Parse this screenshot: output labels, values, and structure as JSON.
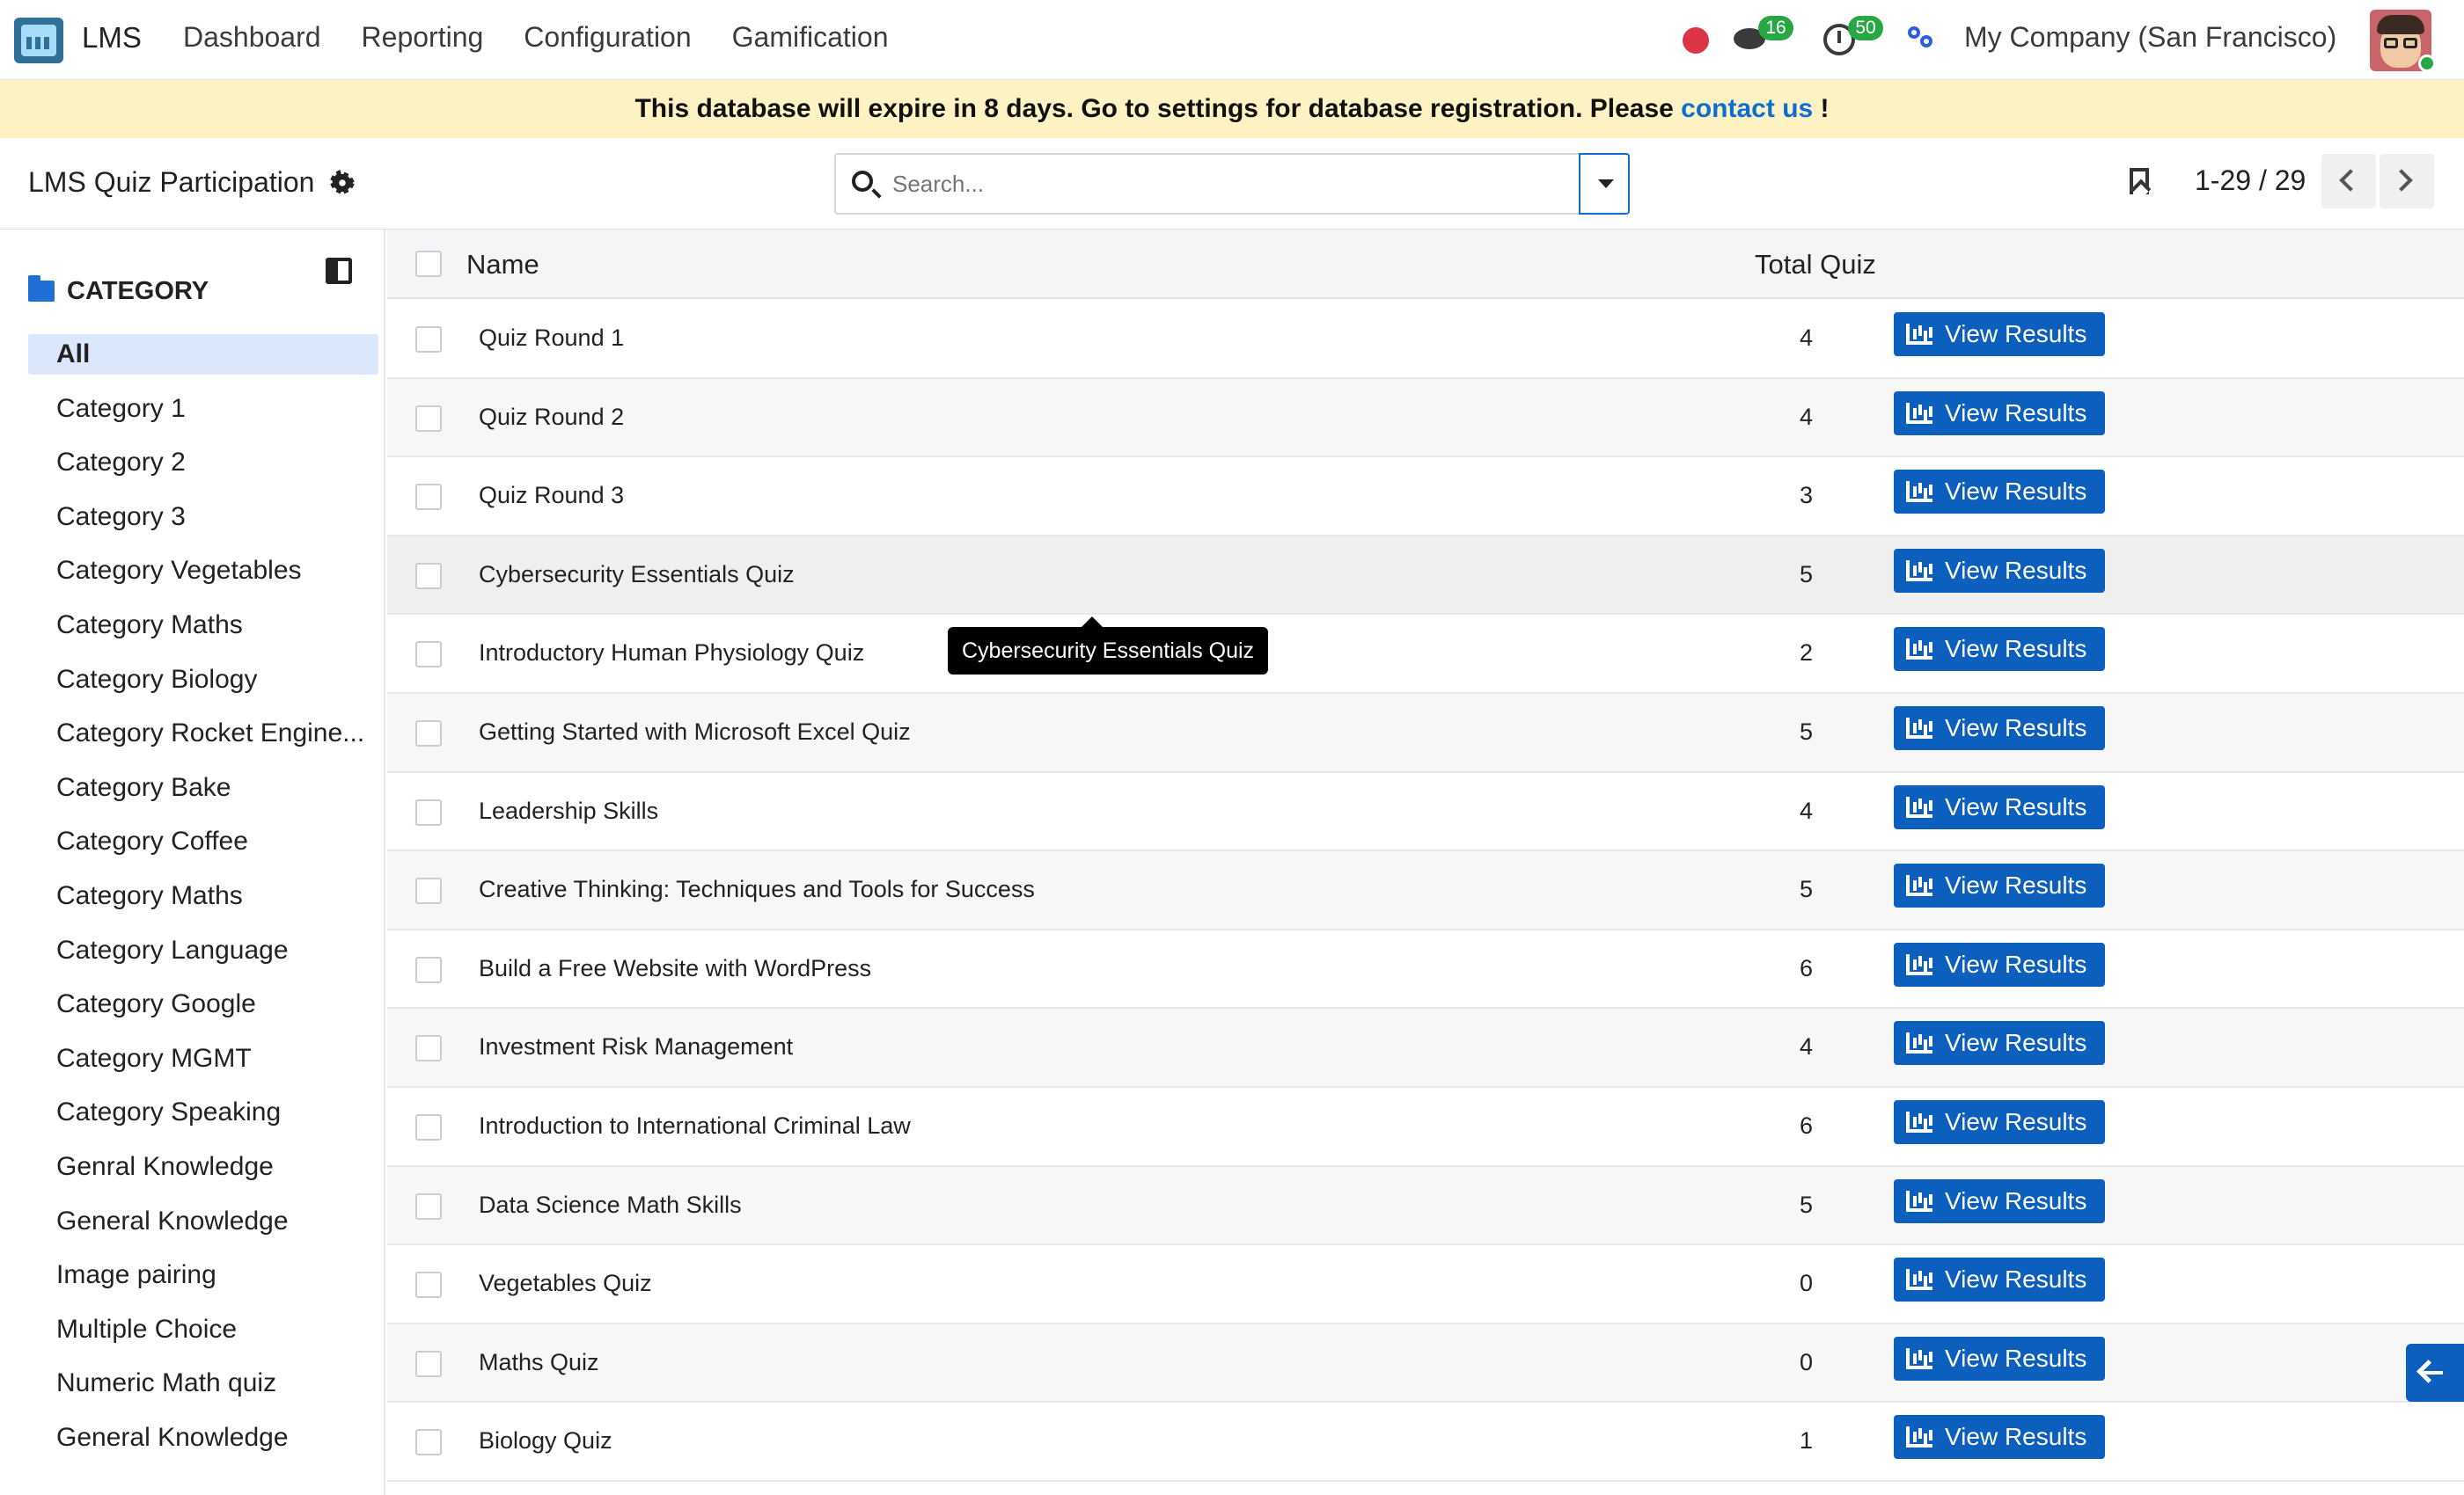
{
  "app": {
    "name": "LMS"
  },
  "nav": {
    "items": [
      "Dashboard",
      "Reporting",
      "Configuration",
      "Gamification"
    ]
  },
  "systray": {
    "chat_count": "16",
    "activity_count": "50",
    "company": "My Company (San Francisco)"
  },
  "banner": {
    "text": "This database will expire in 8 days. Go to settings for database registration. Please ",
    "link": "contact us",
    "suffix": " !"
  },
  "control": {
    "title": "LMS Quiz Participation",
    "search_placeholder": "Search...",
    "pager": "1-29 / 29"
  },
  "sidebar": {
    "title": "CATEGORY",
    "items": [
      "All",
      "Category 1",
      "Category 2",
      "Category 3",
      "Category Vegetables",
      "Category Maths",
      "Category Biology",
      "Category Rocket Engine...",
      "Category Bake",
      "Category Coffee",
      "Category Maths",
      "Category Language",
      "Category Google",
      "Category MGMT",
      "Category Speaking",
      "Genral Knowledge",
      "General Knowledge",
      "Image pairing",
      "Multiple Choice",
      "Numeric Math quiz",
      "General Knowledge"
    ]
  },
  "list": {
    "headers": {
      "name": "Name",
      "total": "Total Quiz"
    },
    "button_label": "View Results",
    "rows": [
      {
        "name": "Quiz Round 1",
        "total": "4"
      },
      {
        "name": "Quiz Round 2",
        "total": "4"
      },
      {
        "name": "Quiz Round 3",
        "total": "3"
      },
      {
        "name": "Cybersecurity Essentials Quiz",
        "total": "5"
      },
      {
        "name": "Introductory Human Physiology Quiz",
        "total": "2"
      },
      {
        "name": "Getting Started with Microsoft Excel Quiz",
        "total": "5"
      },
      {
        "name": "Leadership Skills",
        "total": "4"
      },
      {
        "name": "Creative Thinking: Techniques and Tools for Success",
        "total": "5"
      },
      {
        "name": "Build a Free Website with WordPress",
        "total": "6"
      },
      {
        "name": "Investment Risk Management",
        "total": "4"
      },
      {
        "name": "Introduction to International Criminal Law",
        "total": "6"
      },
      {
        "name": "Data Science Math Skills",
        "total": "5"
      },
      {
        "name": "Vegetables Quiz",
        "total": "0"
      },
      {
        "name": "Maths Quiz",
        "total": "0"
      },
      {
        "name": "Biology Quiz",
        "total": "1"
      }
    ]
  },
  "tooltip": {
    "text": "Cybersecurity Essentials Quiz"
  }
}
